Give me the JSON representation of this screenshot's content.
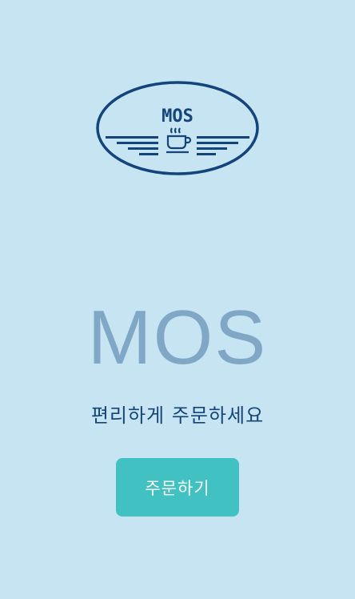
{
  "logo": {
    "text": "MOS",
    "icon": "coffee-cup-icon"
  },
  "brand": {
    "title": "MOS"
  },
  "tagline": "편리하게 주문하세요",
  "order_button": {
    "label": "주문하기"
  },
  "colors": {
    "background": "#c6e4f1",
    "logo": "#13447c",
    "brand_title": "#80a8c6",
    "tagline": "#174478",
    "button": "#41c1c1",
    "button_text": "#ffffff"
  }
}
